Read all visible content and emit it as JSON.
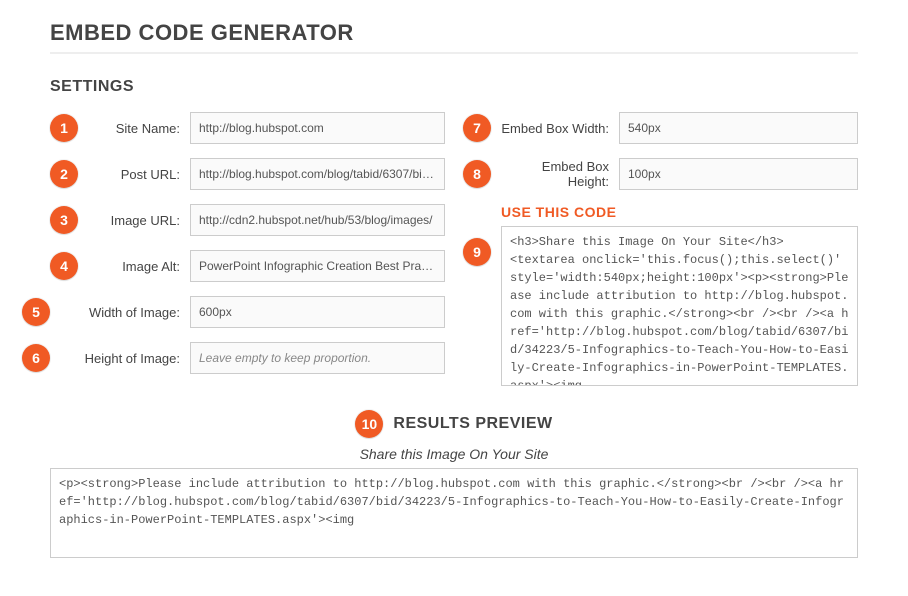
{
  "title": "EMBED CODE GENERATOR",
  "settings_title": "SETTINGS",
  "badge_color": "#f05a24",
  "fields": {
    "site_name": {
      "num": "1",
      "label": "Site Name:",
      "value": "http://blog.hubspot.com"
    },
    "post_url": {
      "num": "2",
      "label": "Post URL:",
      "value": "http://blog.hubspot.com/blog/tabid/6307/bid/34223/5-Infographics-to-Teach-You-How-to-Easily-Create-Infographics-in-PowerPoint-TEMPLATES.aspx"
    },
    "image_url": {
      "num": "3",
      "label": "Image URL:",
      "value": "http://cdn2.hubspot.net/hub/53/blog/images/"
    },
    "image_alt": {
      "num": "4",
      "label": "Image Alt:",
      "value": "PowerPoint Infographic Creation Best Practices"
    },
    "width_img": {
      "num": "5",
      "label": "Width of Image:",
      "value": "600px"
    },
    "height_img": {
      "num": "6",
      "label": "Height of Image:",
      "value": "",
      "placeholder": "Leave empty to keep proportion."
    },
    "box_width": {
      "num": "7",
      "label": "Embed Box Width:",
      "value": "540px"
    },
    "box_height": {
      "num": "8",
      "label": "Embed Box Height:",
      "value": "100px"
    }
  },
  "code_section": {
    "num": "9",
    "heading": "USE THIS CODE",
    "code": "<h3>Share this Image On Your Site</h3>\n<textarea onclick='this.focus();this.select()' style='width:540px;height:100px'><p><strong>Please include attribution to http://blog.hubspot.com with this graphic.</strong><br /><br /><a href='http://blog.hubspot.com/blog/tabid/6307/bid/34223/5-Infographics-to-Teach-You-How-to-Easily-Create-Infographics-in-PowerPoint-TEMPLATES.aspx'><img"
  },
  "preview": {
    "num": "10",
    "heading": "RESULTS PREVIEW",
    "share_caption": "Share this Image On Your Site",
    "code": "<p><strong>Please include attribution to http://blog.hubspot.com with this graphic.</strong><br /><br /><a href='http://blog.hubspot.com/blog/tabid/6307/bid/34223/5-Infographics-to-Teach-You-How-to-Easily-Create-Infographics-in-PowerPoint-TEMPLATES.aspx'><img"
  }
}
